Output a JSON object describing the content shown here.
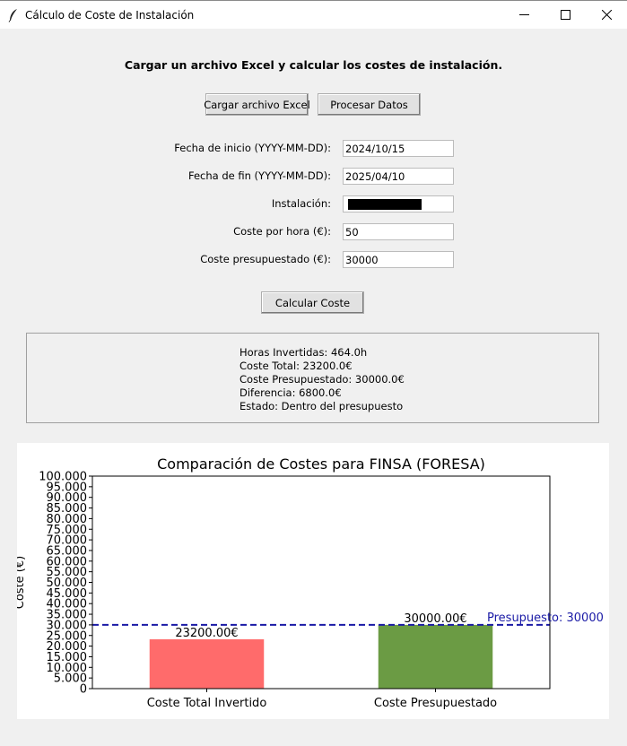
{
  "window": {
    "title": "Cálculo de Coste de Instalación",
    "icon": "feather-icon",
    "minimize_icon": "minimize-icon",
    "maximize_icon": "maximize-icon",
    "close_icon": "close-icon"
  },
  "header": {
    "instruction": "Cargar un archivo Excel y calcular los costes de instalación."
  },
  "toolbar": {
    "load_label": "Cargar archivo Excel",
    "process_label": "Procesar Datos"
  },
  "form": {
    "start_date": {
      "label": "Fecha de inicio (YYYY-MM-DD):",
      "value": "2024/10/15"
    },
    "end_date": {
      "label": "Fecha de fin (YYYY-MM-DD):",
      "value": "2025/04/10"
    },
    "installation": {
      "label": "Instalación:",
      "value": ""
    },
    "cost_per_hour": {
      "label": "Coste por hora (€):",
      "value": "50"
    },
    "budget": {
      "label": "Coste presupuestado (€):",
      "value": "30000"
    }
  },
  "calculate_label": "Calcular Coste",
  "results": {
    "hours": "Horas Invertidas: 464.0h",
    "total": "Coste Total: 23200.0€",
    "budgeted": "Coste Presupuestado: 30000.0€",
    "difference": "Diferencia: 6800.0€",
    "status": "Estado: Dentro del presupuesto"
  },
  "chart_data": {
    "type": "bar",
    "title": "Comparación de Costes para FINSA (FORESA)",
    "xlabel": "",
    "ylabel": "Coste (€)",
    "categories": [
      "Coste Total Invertido",
      "Coste Presupuestado"
    ],
    "values": [
      23200,
      30000
    ],
    "value_labels": [
      "23200.00€",
      "30000.00€"
    ],
    "colors": [
      "#ff6b6b",
      "#6b9b44"
    ],
    "ylim": [
      0,
      100000
    ],
    "yticks": [
      "0",
      "5.000",
      "10.000",
      "15.000",
      "20.000",
      "25.000",
      "30.000",
      "35.000",
      "40.000",
      "45.000",
      "50.000",
      "55.000",
      "60.000",
      "65.000",
      "70.000",
      "75.000",
      "80.000",
      "85.000",
      "90.000",
      "95.000",
      "100.000"
    ],
    "reference_line": {
      "value": 30000,
      "label": "Presupuesto: 30000",
      "color": "#1a1aa6"
    },
    "grid": false
  }
}
